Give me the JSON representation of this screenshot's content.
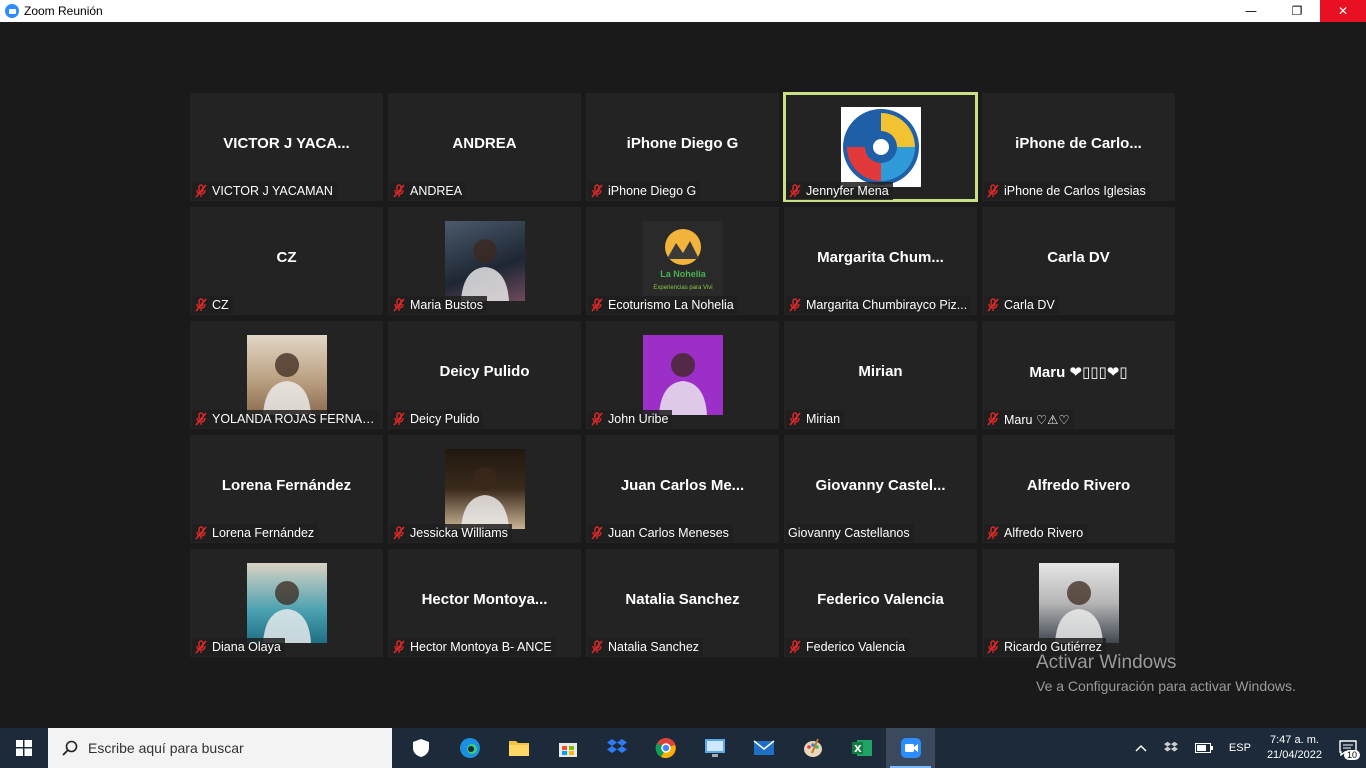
{
  "window": {
    "title": "Zoom Reunión",
    "minimize": "—",
    "maximize": "❐",
    "close": "✕"
  },
  "tiles": [
    {
      "big": "VICTOR J YACA...",
      "name": "VICTOR J YACAMAN",
      "muted": true
    },
    {
      "big": "ANDREA",
      "name": "ANDREA",
      "muted": true
    },
    {
      "big": "iPhone  Diego G",
      "name": "iPhone  Diego G",
      "muted": true
    },
    {
      "big": "",
      "name": "Jennyfer Mena",
      "muted": true,
      "active": true,
      "picture": "logo-swirl"
    },
    {
      "big": "iPhone  de  Carlo...",
      "name": "iPhone de Carlos Iglesias",
      "muted": true
    },
    {
      "big": "CZ",
      "name": "CZ",
      "muted": true
    },
    {
      "big": "",
      "name": "Maria Bustos",
      "muted": true,
      "picture": "photo-woman1"
    },
    {
      "big": "",
      "name": "Ecoturismo La Nohelia",
      "muted": true,
      "picture": "logo-nohelia"
    },
    {
      "big": "Margarita  Chum...",
      "name": "Margarita Chumbirayco Piz...",
      "muted": true
    },
    {
      "big": "Carla DV",
      "name": "Carla DV",
      "muted": true
    },
    {
      "big": "",
      "name": "YOLANDA ROJAS FERNAN...",
      "muted": true,
      "picture": "photo-yolanda"
    },
    {
      "big": "Deicy Pulido",
      "name": "Deicy Pulido",
      "muted": true
    },
    {
      "big": "",
      "name": "John Uribe",
      "muted": true,
      "picture": "photo-john"
    },
    {
      "big": "Mirian",
      "name": "Mirian",
      "muted": true
    },
    {
      "big": "Maru ❤▯▯▯❤▯",
      "name": "Maru ♡⚠♡",
      "muted": true
    },
    {
      "big": "Lorena Fernández",
      "name": "Lorena Fernández",
      "muted": true
    },
    {
      "big": "",
      "name": "Jessicka Williams",
      "muted": true,
      "picture": "photo-jessicka"
    },
    {
      "big": "Juan Carlos  Me...",
      "name": "Juan Carlos Meneses",
      "muted": true
    },
    {
      "big": "Giovanny  Castel...",
      "name": "Giovanny Castellanos",
      "muted": false
    },
    {
      "big": "Alfredo Rivero",
      "name": "Alfredo Rivero",
      "muted": true
    },
    {
      "big": "",
      "name": "Diana Olaya",
      "muted": true,
      "picture": "photo-diana"
    },
    {
      "big": "Hector  Montoya...",
      "name": "Hector Montoya B- ANCE",
      "muted": true
    },
    {
      "big": "Natalia Sanchez",
      "name": "Natalia Sanchez",
      "muted": true
    },
    {
      "big": "Federico Valencia",
      "name": "Federico Valencia",
      "muted": true
    },
    {
      "big": "",
      "name": "Ricardo Gutiérrez",
      "muted": true,
      "picture": "photo-ricardo"
    }
  ],
  "logo_text": {
    "nohelia_name": "La Nohelia",
    "nohelia_tag": "Experiencias para Vivi"
  },
  "watermark": {
    "title": "Activar Windows",
    "subtitle": "Ve a Configuración para activar Windows."
  },
  "taskbar": {
    "search_placeholder": "Escribe aquí para buscar",
    "language": "ESP",
    "time": "7:47 a. m.",
    "date": "21/04/2022",
    "notification_count": "10"
  },
  "colors": {
    "active_speaker_border": "#c8e086",
    "mute_icon": "#e02828",
    "tile_bg": "#232323",
    "close_button": "#e81123"
  }
}
